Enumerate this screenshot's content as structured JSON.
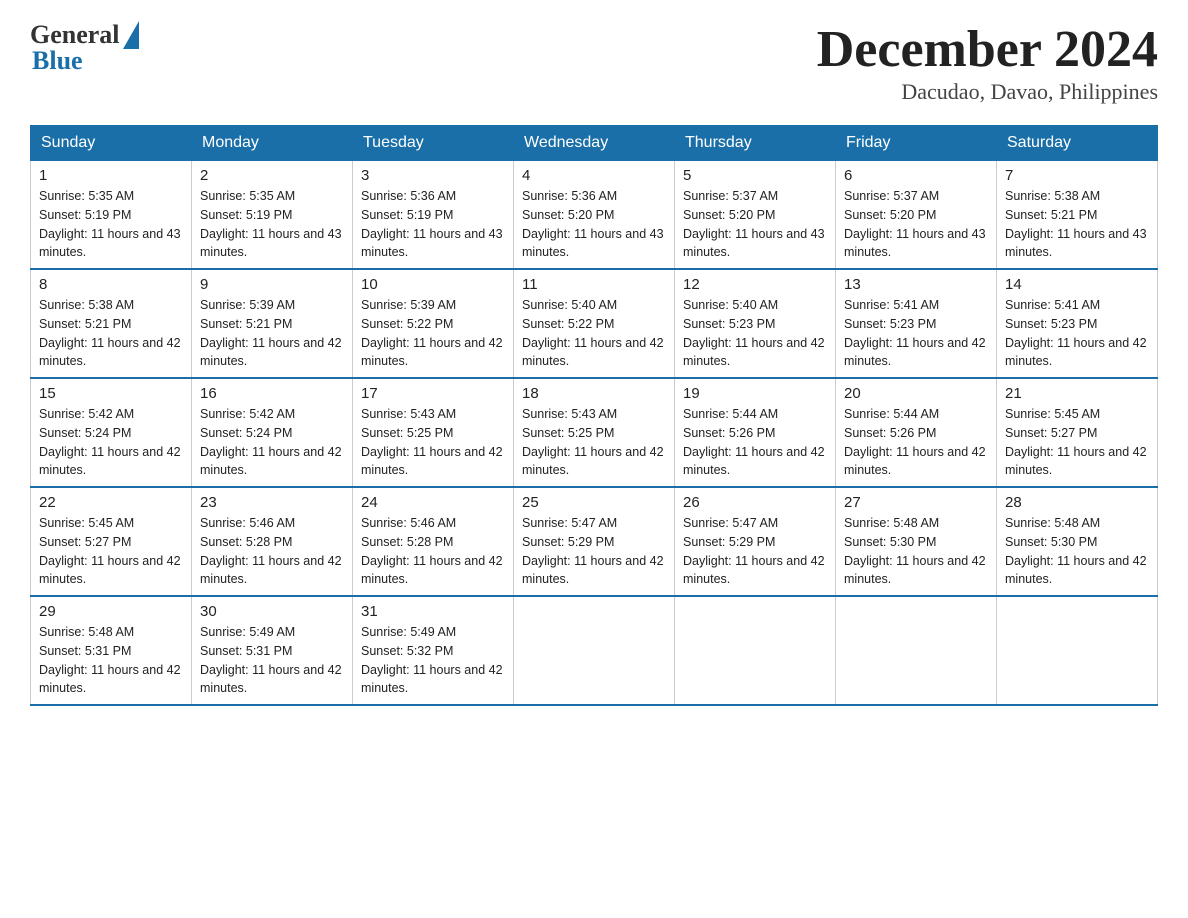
{
  "logo": {
    "general": "General",
    "blue": "Blue"
  },
  "title": {
    "month_year": "December 2024",
    "location": "Dacudao, Davao, Philippines"
  },
  "days_of_week": [
    "Sunday",
    "Monday",
    "Tuesday",
    "Wednesday",
    "Thursday",
    "Friday",
    "Saturday"
  ],
  "weeks": [
    [
      {
        "day": "1",
        "sunrise": "5:35 AM",
        "sunset": "5:19 PM",
        "daylight": "11 hours and 43 minutes."
      },
      {
        "day": "2",
        "sunrise": "5:35 AM",
        "sunset": "5:19 PM",
        "daylight": "11 hours and 43 minutes."
      },
      {
        "day": "3",
        "sunrise": "5:36 AM",
        "sunset": "5:19 PM",
        "daylight": "11 hours and 43 minutes."
      },
      {
        "day": "4",
        "sunrise": "5:36 AM",
        "sunset": "5:20 PM",
        "daylight": "11 hours and 43 minutes."
      },
      {
        "day": "5",
        "sunrise": "5:37 AM",
        "sunset": "5:20 PM",
        "daylight": "11 hours and 43 minutes."
      },
      {
        "day": "6",
        "sunrise": "5:37 AM",
        "sunset": "5:20 PM",
        "daylight": "11 hours and 43 minutes."
      },
      {
        "day": "7",
        "sunrise": "5:38 AM",
        "sunset": "5:21 PM",
        "daylight": "11 hours and 43 minutes."
      }
    ],
    [
      {
        "day": "8",
        "sunrise": "5:38 AM",
        "sunset": "5:21 PM",
        "daylight": "11 hours and 42 minutes."
      },
      {
        "day": "9",
        "sunrise": "5:39 AM",
        "sunset": "5:21 PM",
        "daylight": "11 hours and 42 minutes."
      },
      {
        "day": "10",
        "sunrise": "5:39 AM",
        "sunset": "5:22 PM",
        "daylight": "11 hours and 42 minutes."
      },
      {
        "day": "11",
        "sunrise": "5:40 AM",
        "sunset": "5:22 PM",
        "daylight": "11 hours and 42 minutes."
      },
      {
        "day": "12",
        "sunrise": "5:40 AM",
        "sunset": "5:23 PM",
        "daylight": "11 hours and 42 minutes."
      },
      {
        "day": "13",
        "sunrise": "5:41 AM",
        "sunset": "5:23 PM",
        "daylight": "11 hours and 42 minutes."
      },
      {
        "day": "14",
        "sunrise": "5:41 AM",
        "sunset": "5:23 PM",
        "daylight": "11 hours and 42 minutes."
      }
    ],
    [
      {
        "day": "15",
        "sunrise": "5:42 AM",
        "sunset": "5:24 PM",
        "daylight": "11 hours and 42 minutes."
      },
      {
        "day": "16",
        "sunrise": "5:42 AM",
        "sunset": "5:24 PM",
        "daylight": "11 hours and 42 minutes."
      },
      {
        "day": "17",
        "sunrise": "5:43 AM",
        "sunset": "5:25 PM",
        "daylight": "11 hours and 42 minutes."
      },
      {
        "day": "18",
        "sunrise": "5:43 AM",
        "sunset": "5:25 PM",
        "daylight": "11 hours and 42 minutes."
      },
      {
        "day": "19",
        "sunrise": "5:44 AM",
        "sunset": "5:26 PM",
        "daylight": "11 hours and 42 minutes."
      },
      {
        "day": "20",
        "sunrise": "5:44 AM",
        "sunset": "5:26 PM",
        "daylight": "11 hours and 42 minutes."
      },
      {
        "day": "21",
        "sunrise": "5:45 AM",
        "sunset": "5:27 PM",
        "daylight": "11 hours and 42 minutes."
      }
    ],
    [
      {
        "day": "22",
        "sunrise": "5:45 AM",
        "sunset": "5:27 PM",
        "daylight": "11 hours and 42 minutes."
      },
      {
        "day": "23",
        "sunrise": "5:46 AM",
        "sunset": "5:28 PM",
        "daylight": "11 hours and 42 minutes."
      },
      {
        "day": "24",
        "sunrise": "5:46 AM",
        "sunset": "5:28 PM",
        "daylight": "11 hours and 42 minutes."
      },
      {
        "day": "25",
        "sunrise": "5:47 AM",
        "sunset": "5:29 PM",
        "daylight": "11 hours and 42 minutes."
      },
      {
        "day": "26",
        "sunrise": "5:47 AM",
        "sunset": "5:29 PM",
        "daylight": "11 hours and 42 minutes."
      },
      {
        "day": "27",
        "sunrise": "5:48 AM",
        "sunset": "5:30 PM",
        "daylight": "11 hours and 42 minutes."
      },
      {
        "day": "28",
        "sunrise": "5:48 AM",
        "sunset": "5:30 PM",
        "daylight": "11 hours and 42 minutes."
      }
    ],
    [
      {
        "day": "29",
        "sunrise": "5:48 AM",
        "sunset": "5:31 PM",
        "daylight": "11 hours and 42 minutes."
      },
      {
        "day": "30",
        "sunrise": "5:49 AM",
        "sunset": "5:31 PM",
        "daylight": "11 hours and 42 minutes."
      },
      {
        "day": "31",
        "sunrise": "5:49 AM",
        "sunset": "5:32 PM",
        "daylight": "11 hours and 42 minutes."
      },
      null,
      null,
      null,
      null
    ]
  ]
}
